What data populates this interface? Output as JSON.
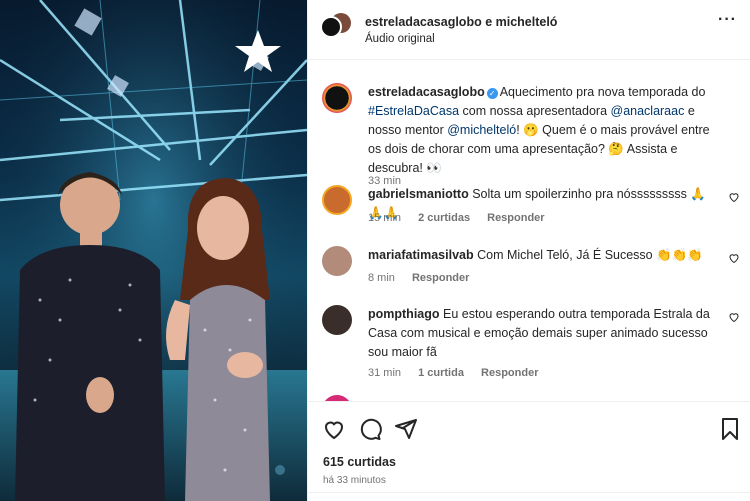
{
  "header": {
    "title": "estreladacasaglobo e michelteló",
    "subtitle": "Áudio original"
  },
  "caption": {
    "user": "estreladacasaglobo",
    "part1": "Aquecimento pra nova temporada do ",
    "hashtag": "#EstrelaDaCasa",
    "part2": " com nossa apresentadora ",
    "mention1": "@anaclaraac",
    "part3": " e nosso mentor ",
    "mention2": "@michelteló",
    "part4": "! 🫢 Quem é o mais provável entre os dois de chorar com uma apresentação? 🤔 Assista e descubra! 👀",
    "time": "33 min"
  },
  "comments": [
    {
      "user": "gabrielsmaniotto",
      "text": "Solta um spoilerzinho pra nósssssssss 🙏🙏🙏",
      "time": "15 min",
      "likes": "2 curtidas",
      "reply": "Responder"
    },
    {
      "user": "mariafatimasilvab",
      "text": "Com Michel Teló, Já É Sucesso 👏👏👏",
      "time": "8 min",
      "reply": "Responder"
    },
    {
      "user": "pompthiago",
      "text": "Eu estou esperando outra temporada Estrala da Casa com musical e emoção demais super animado sucesso sou maior fã",
      "time": "31 min",
      "likes": "1 curtida",
      "reply": "Responder"
    }
  ],
  "footer": {
    "likes": "615 curtidas",
    "ago": "há 33 minutos"
  },
  "icons": [
    "heart-icon",
    "comment-icon",
    "share-icon",
    "bookmark-icon",
    "more-icon",
    "verified-icon",
    "star-logo-icon"
  ],
  "colors": {
    "link": "#00376b",
    "verified": "#3897f0",
    "muted": "#737373"
  }
}
